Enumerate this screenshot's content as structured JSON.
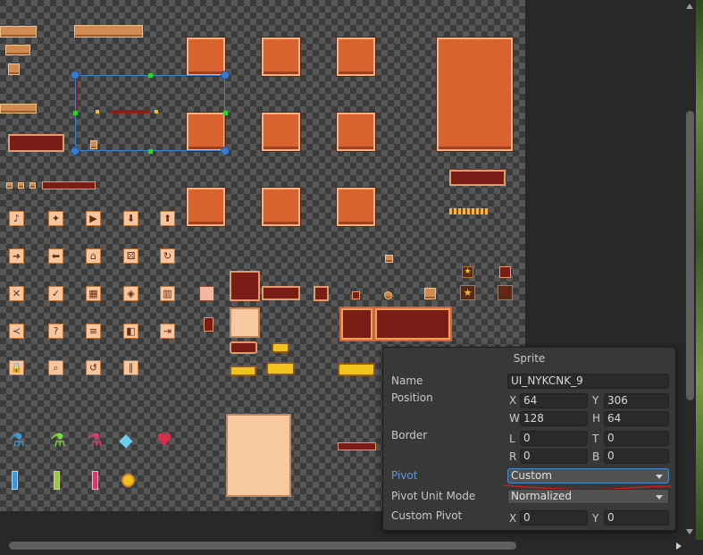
{
  "sprite_panel": {
    "title": "Sprite",
    "name_label": "Name",
    "name_value": "UI_NYKCNK_9",
    "position_label": "Position",
    "pos_x_label": "X",
    "pos_x_value": "64",
    "pos_y_label": "Y",
    "pos_y_value": "306",
    "pos_w_label": "W",
    "pos_w_value": "128",
    "pos_h_label": "H",
    "pos_h_value": "64",
    "border_label": "Border",
    "border_l_label": "L",
    "border_l_value": "0",
    "border_t_label": "T",
    "border_t_value": "0",
    "border_r_label": "R",
    "border_r_value": "0",
    "border_b_label": "B",
    "border_b_value": "0",
    "pivot_label": "Pivot",
    "pivot_value": "Custom",
    "pivot_unit_label": "Pivot Unit Mode",
    "pivot_unit_value": "Normalized",
    "custom_pivot_label": "Custom Pivot",
    "custom_x_label": "X",
    "custom_x_value": "0",
    "custom_y_label": "Y",
    "custom_y_value": "0"
  },
  "icons": {
    "row1": [
      "music-icon",
      "run-icon",
      "play-icon",
      "download-icon",
      "upload-icon"
    ],
    "row1_glyphs": [
      "♪",
      "✦",
      "▶",
      "⬇",
      "⬆"
    ],
    "row2": [
      "arrow-right-icon",
      "arrow-left-icon",
      "home-icon",
      "dice-icon",
      "refresh-icon"
    ],
    "row2_glyphs": [
      "➜",
      "⬅",
      "⌂",
      "⚄",
      "↻"
    ],
    "row3": [
      "close-icon",
      "check-icon",
      "shop-icon",
      "controller-icon",
      "trash-icon"
    ],
    "row3_glyphs": [
      "✕",
      "✓",
      "▦",
      "◈",
      "▥"
    ],
    "row4": [
      "share-icon",
      "help-icon",
      "list-icon",
      "sound-icon",
      "exit-icon"
    ],
    "row4_glyphs": [
      "≺",
      "?",
      "≡",
      "◧",
      "⇥"
    ],
    "row5": [
      "lock-icon",
      "zoom-icon",
      "restart-icon",
      "pause-icon"
    ],
    "row5_glyphs": [
      "🔒",
      "⌕",
      "↺",
      "∥"
    ],
    "items": [
      "blue-potion-icon",
      "green-potion-icon",
      "red-potion-icon",
      "diamond-icon",
      "heart-icon"
    ],
    "items_glyphs": [
      "⚗",
      "⚗",
      "⚗",
      "◆",
      "♥"
    ],
    "stars": [
      "star-icon",
      "star-icon-large"
    ],
    "stars_glyphs": [
      "★",
      "★"
    ]
  },
  "colors": {
    "selection_outline": "#3c80c8",
    "pivot_annotation": "#c81e1e",
    "panel_orange": "#d9622f"
  }
}
